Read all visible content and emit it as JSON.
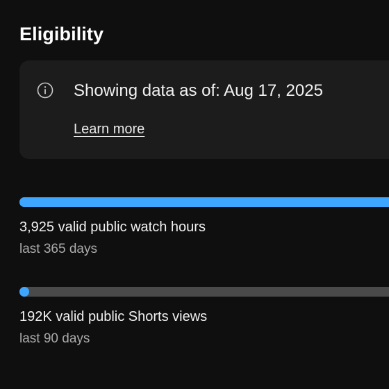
{
  "section": {
    "title": "Eligibility"
  },
  "info": {
    "icon": "info-icon",
    "text": "Showing data as of: Aug 17, 2025",
    "link": "Learn more"
  },
  "metrics": [
    {
      "label": "3,925 valid public watch hours",
      "period": "last 365 days",
      "progress": 1.0
    },
    {
      "label": "192K valid public Shorts views",
      "period": "last 90 days",
      "progress": 0.0
    }
  ],
  "colors": {
    "background": "#0f0f0f",
    "card": "#1c1c1c",
    "progress_fill": "#3ea6ff",
    "progress_track": "#4a4a4a"
  }
}
